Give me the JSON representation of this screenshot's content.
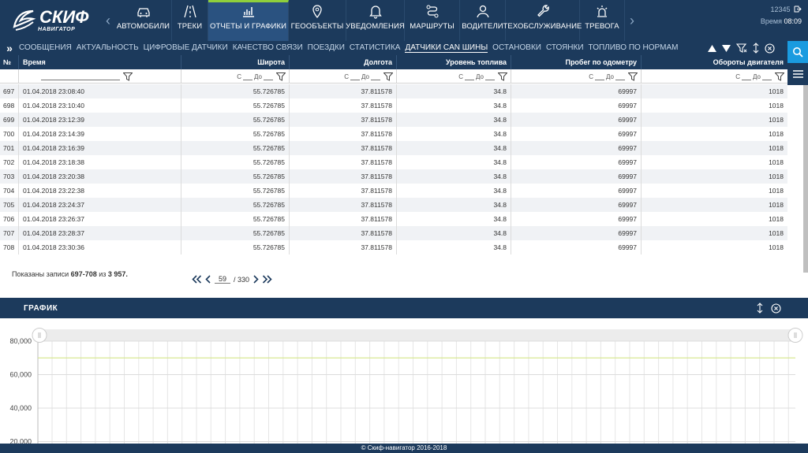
{
  "brand": {
    "name": "СКИФ",
    "sub": "НАВИГАТОР"
  },
  "nav": [
    {
      "label": "АВТОМОБИЛИ",
      "icon": "car-icon",
      "width": 72
    },
    {
      "label": "ТРЕКИ",
      "icon": "road-icon",
      "width": 46
    },
    {
      "label": "ОТЧЕТЫ И ГРАФИКИ",
      "icon": "chart-icon",
      "width": 102,
      "active": true
    },
    {
      "label": "ГЕООБЪЕКТЫ",
      "icon": "location-pin-icon",
      "width": 73
    },
    {
      "label": "УВЕДОМЛЕНИЯ",
      "icon": "bell-icon",
      "width": 74
    },
    {
      "label": "МАРШРУТЫ",
      "icon": "route-icon",
      "width": 70
    },
    {
      "label": "ВОДИТЕЛИ",
      "icon": "user-icon",
      "width": 58
    },
    {
      "label": "ТЕХОБСЛУЖИВАНИЕ",
      "icon": "wrench-icon",
      "width": 94
    },
    {
      "label": "ТРЕВОГА",
      "icon": "siren-icon",
      "width": 57
    }
  ],
  "user": {
    "id": "12345",
    "time_label": "Время",
    "time": "08:09"
  },
  "subtabs": [
    {
      "label": "СООБЩЕНИЯ"
    },
    {
      "label": "АКТУАЛЬНОСТЬ"
    },
    {
      "label": "ЦИФРОВЫЕ ДАТЧИКИ"
    },
    {
      "label": "КАЧЕСТВО СВЯЗИ"
    },
    {
      "label": "ПОЕЗДКИ"
    },
    {
      "label": "СТАТИСТИКА"
    },
    {
      "label": "ДАТЧИКИ CAN ШИНЫ",
      "active": true
    },
    {
      "label": "ОСТАНОВКИ"
    },
    {
      "label": "СТОЯНКИ"
    },
    {
      "label": "ТОПЛИВО ПО НОРМАМ"
    }
  ],
  "table": {
    "columns": {
      "no": "№",
      "time": "Время",
      "lat": "Широта",
      "lon": "Долгота",
      "fuel": "Уровень топлива",
      "odo": "Пробег по одометру",
      "eng": "Обороты двигателя"
    },
    "filter_from": "С",
    "filter_to": "До",
    "rows": [
      {
        "no": "697",
        "time": "01.04.2018 23:08:40",
        "lat": "55.726785",
        "lon": "37.811578",
        "fuel": "34.8",
        "odo": "69997",
        "eng": "1018"
      },
      {
        "no": "698",
        "time": "01.04.2018 23:10:40",
        "lat": "55.726785",
        "lon": "37.811578",
        "fuel": "34.8",
        "odo": "69997",
        "eng": "1018"
      },
      {
        "no": "699",
        "time": "01.04.2018 23:12:39",
        "lat": "55.726785",
        "lon": "37.811578",
        "fuel": "34.8",
        "odo": "69997",
        "eng": "1018"
      },
      {
        "no": "700",
        "time": "01.04.2018 23:14:39",
        "lat": "55.726785",
        "lon": "37.811578",
        "fuel": "34.8",
        "odo": "69997",
        "eng": "1018"
      },
      {
        "no": "701",
        "time": "01.04.2018 23:16:39",
        "lat": "55.726785",
        "lon": "37.811578",
        "fuel": "34.8",
        "odo": "69997",
        "eng": "1018"
      },
      {
        "no": "702",
        "time": "01.04.2018 23:18:38",
        "lat": "55.726785",
        "lon": "37.811578",
        "fuel": "34.8",
        "odo": "69997",
        "eng": "1018"
      },
      {
        "no": "703",
        "time": "01.04.2018 23:20:38",
        "lat": "55.726785",
        "lon": "37.811578",
        "fuel": "34.8",
        "odo": "69997",
        "eng": "1018"
      },
      {
        "no": "704",
        "time": "01.04.2018 23:22:38",
        "lat": "55.726785",
        "lon": "37.811578",
        "fuel": "34.8",
        "odo": "69997",
        "eng": "1018"
      },
      {
        "no": "705",
        "time": "01.04.2018 23:24:37",
        "lat": "55.726785",
        "lon": "37.811578",
        "fuel": "34.8",
        "odo": "69997",
        "eng": "1018"
      },
      {
        "no": "706",
        "time": "01.04.2018 23:26:37",
        "lat": "55.726785",
        "lon": "37.811578",
        "fuel": "34.8",
        "odo": "69997",
        "eng": "1018"
      },
      {
        "no": "707",
        "time": "01.04.2018 23:28:37",
        "lat": "55.726785",
        "lon": "37.811578",
        "fuel": "34.8",
        "odo": "69997",
        "eng": "1018"
      },
      {
        "no": "708",
        "time": "01.04.2018 23:30:36",
        "lat": "55.726785",
        "lon": "37.811578",
        "fuel": "34.8",
        "odo": "69997",
        "eng": "1018"
      }
    ]
  },
  "pager": {
    "shown_prefix": "Показаны записи",
    "range": "697-708",
    "of": "из",
    "total": "3 957.",
    "page": "59",
    "pages": "/ 330"
  },
  "graph": {
    "title": "ГРАФИК",
    "colors": {
      "line": "#d6e68a",
      "grid": "#e6e6e6"
    }
  },
  "chart_data": {
    "type": "line",
    "yticks": [
      "80,000",
      "60,000",
      "40,000",
      "20,000"
    ],
    "ylim": [
      20000,
      80000
    ],
    "series": [
      {
        "values": [
          69997,
          69997,
          69997,
          69997,
          69997,
          69997,
          69997,
          69997,
          69997,
          69997,
          69997,
          69997
        ]
      }
    ],
    "grid": true
  },
  "footer": {
    "text": "© Скиф-навигатор 2016-2018"
  }
}
